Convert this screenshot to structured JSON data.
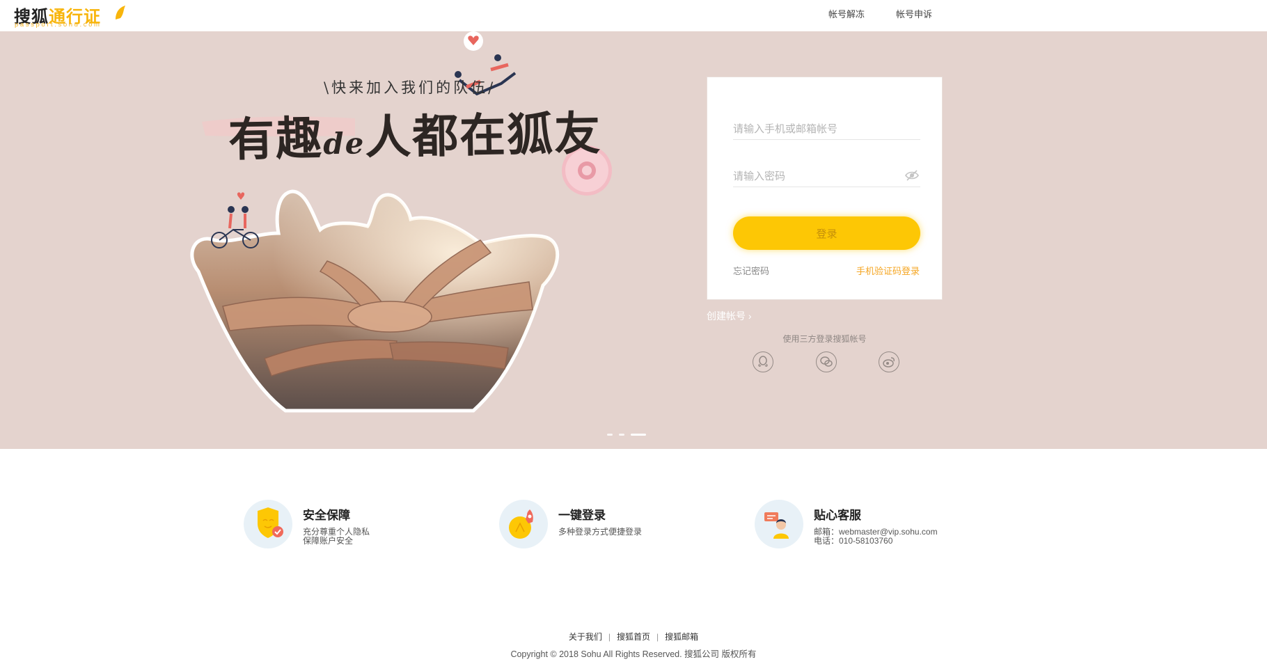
{
  "header": {
    "logo": {
      "brand": "搜狐",
      "product": "通行证",
      "domain": "passport.sohu.com"
    },
    "links": [
      {
        "label": "帐号解冻"
      },
      {
        "label": "帐号申诉"
      }
    ]
  },
  "banner": {
    "tagline": "\\快来加入我们的队伍/",
    "headline": {
      "part1": "有趣",
      "part2": "de",
      "part3": "人都在狐友"
    },
    "slides": {
      "count": 3,
      "active": 3
    }
  },
  "login": {
    "username_placeholder": "请输入手机或邮箱帐号",
    "password_placeholder": "请输入密码",
    "submit_label": "登录",
    "forgot_label": "忘记密码",
    "sms_label": "手机验证码登录",
    "create_account_label": "创建帐号 ›",
    "third_party_title": "使用三方登录搜狐帐号",
    "third_party": [
      "qq-icon",
      "wechat-icon",
      "weibo-icon"
    ]
  },
  "features": [
    {
      "icon": "shield-icon",
      "title": "安全保障",
      "lines": [
        "充分尊重个人隐私",
        "保障账户安全"
      ]
    },
    {
      "icon": "rocket-icon",
      "title": "一键登录",
      "lines": [
        "多种登录方式便捷登录",
        ""
      ]
    },
    {
      "icon": "support-agent-icon",
      "title": "贴心客服",
      "lines": [
        "邮箱：webmaster@vip.sohu.com",
        "电话：010-58103760"
      ]
    }
  ],
  "footer": {
    "links": [
      {
        "label": "关于我们"
      },
      {
        "label": "搜狐首页"
      },
      {
        "label": "搜狐邮箱"
      }
    ],
    "copyright": "Copyright © 2018 Sohu All Rights Reserved. 搜狐公司 版权所有"
  },
  "colors": {
    "banner_bg": "#e4d3ce",
    "accent_yellow": "#fdc705",
    "sms_link": "#f5a623",
    "logo_orange": "#f8b50b"
  }
}
